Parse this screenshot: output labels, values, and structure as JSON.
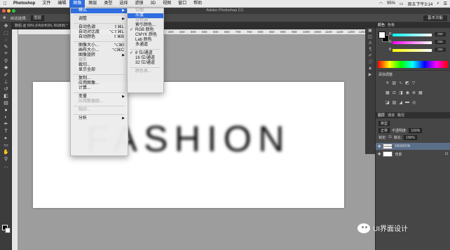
{
  "menubar": {
    "apple": "",
    "items": [
      "Photoshop",
      "文件",
      "编辑",
      "图像",
      "图层",
      "类型",
      "选择",
      "滤镜",
      "3D",
      "视图",
      "窗口",
      "帮助"
    ],
    "status": [
      "95%",
      "周五下午3:14"
    ]
  },
  "window": {
    "title": "Adobe Photoshop CC"
  },
  "options": {
    "auto_select": "自动选择:",
    "layer_sel": "图层",
    "workspace": "基本功能"
  },
  "document": {
    "tab": "数组 @ 50% (FASHION, RGB/8) *"
  },
  "ruler": [
    "200",
    "250",
    "300",
    "350",
    "400",
    "450",
    "500",
    "550",
    "600",
    "650",
    "700",
    "750",
    "800",
    "850",
    "900",
    "950",
    "1000",
    "1050",
    "1100",
    "1150",
    "1200",
    "1250"
  ],
  "canvas": {
    "text": "FASHION"
  },
  "image_menu": [
    {
      "label": "模式",
      "arrow": "▶",
      "state": "hl"
    },
    {
      "sep": true
    },
    {
      "label": "调整",
      "arrow": "▶"
    },
    {
      "sep": true
    },
    {
      "label": "自动色调",
      "sc": "⇧⌘L"
    },
    {
      "label": "自动对比度",
      "sc": "⌥⇧⌘L"
    },
    {
      "label": "自动颜色",
      "sc": "⇧⌘B"
    },
    {
      "sep": true
    },
    {
      "label": "图像大小...",
      "sc": "⌥⌘I"
    },
    {
      "label": "画布大小...",
      "sc": "⌥⌘C"
    },
    {
      "label": "图像旋转",
      "arrow": "▶"
    },
    {
      "label": "裁剪",
      "state": "dis"
    },
    {
      "label": "裁切..."
    },
    {
      "label": "显示全部"
    },
    {
      "sep": true
    },
    {
      "label": "复制..."
    },
    {
      "label": "应用图像..."
    },
    {
      "label": "计算..."
    },
    {
      "sep": true
    },
    {
      "label": "变量",
      "arrow": "▶"
    },
    {
      "label": "应用数据组...",
      "state": "dis"
    },
    {
      "sep": true
    },
    {
      "label": "陷印...",
      "state": "dis"
    },
    {
      "sep": true
    },
    {
      "label": "分析",
      "arrow": "▶"
    }
  ],
  "mode_menu": [
    {
      "label": "位图",
      "state": "dis"
    },
    {
      "label": "灰度",
      "state": "hl"
    },
    {
      "label": "双色调",
      "state": "dis"
    },
    {
      "label": "索引颜色..."
    },
    {
      "label": "RGB 颜色",
      "chk": "✓"
    },
    {
      "label": "CMYK 颜色"
    },
    {
      "label": "Lab 颜色"
    },
    {
      "label": "多通道"
    },
    {
      "sep": true
    },
    {
      "label": "8 位/通道",
      "chk": "✓"
    },
    {
      "label": "16 位/通道"
    },
    {
      "label": "32 位/通道"
    },
    {
      "sep": true
    },
    {
      "label": "颜色表...",
      "state": "dis"
    }
  ],
  "panels": {
    "color_tabs": [
      "颜色",
      "色板"
    ],
    "sliders": [
      {
        "label": "R",
        "value": "255"
      },
      {
        "label": "G",
        "value": "255"
      },
      {
        "label": "B",
        "value": "255"
      }
    ],
    "adj_title": "添加调整",
    "layer_tabs": [
      "图层",
      "通道",
      "路径"
    ],
    "kind": "类型",
    "blend": "正常",
    "opacity_label": "不透明度:",
    "opacity": "100%",
    "lock_label": "锁定:",
    "fill_label": "填充:",
    "fill": "100%",
    "layers": [
      {
        "name": "FASHION",
        "thumb": "FASHION",
        "active": true
      },
      {
        "name": "背景",
        "thumb": "",
        "active": false
      }
    ]
  },
  "watermark": "UI界面设计",
  "colors": {
    "accent": "#2f6de0"
  }
}
